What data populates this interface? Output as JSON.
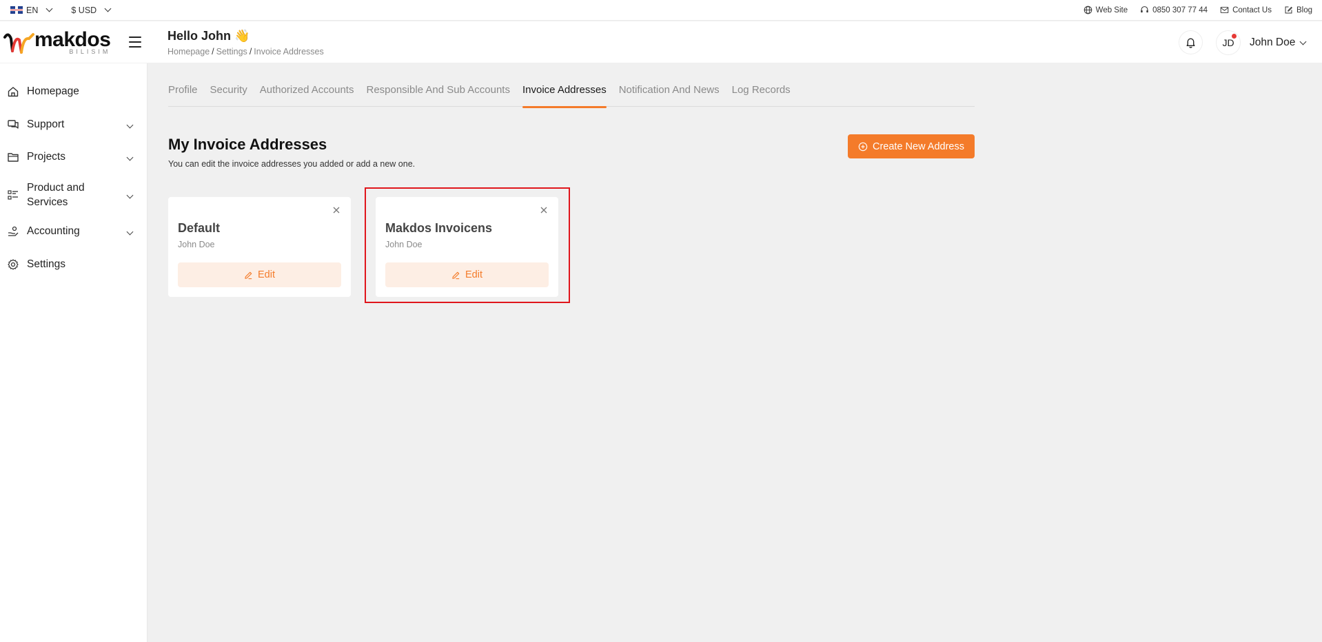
{
  "topbar": {
    "language": "EN",
    "currency": "$ USD",
    "links": [
      {
        "label": "Web Site",
        "icon": "globe-icon"
      },
      {
        "label": "0850 307 77 44",
        "icon": "headset-icon"
      },
      {
        "label": "Contact Us",
        "icon": "mail-icon"
      },
      {
        "label": "Blog",
        "icon": "edit-square-icon"
      }
    ]
  },
  "header": {
    "logo_word": "makdos",
    "logo_sub": "BILISIM",
    "greeting": "Hello John 👋",
    "breadcrumb": [
      "Homepage",
      "Settings",
      "Invoice Addresses"
    ],
    "avatar_initials": "JD",
    "user_name": "John Doe"
  },
  "sidebar": {
    "items": [
      {
        "label": "Homepage",
        "icon": "home-icon",
        "expandable": false
      },
      {
        "label": "Support",
        "icon": "chat-icon",
        "expandable": true
      },
      {
        "label": "Projects",
        "icon": "folder-icon",
        "expandable": true
      },
      {
        "label": "Product and Services",
        "icon": "list-icon",
        "expandable": true
      },
      {
        "label": "Accounting",
        "icon": "hand-coins-icon",
        "expandable": true
      },
      {
        "label": "Settings",
        "icon": "gear-icon",
        "expandable": false
      }
    ]
  },
  "tabs": [
    {
      "label": "Profile",
      "active": false
    },
    {
      "label": "Security",
      "active": false
    },
    {
      "label": "Authorized Accounts",
      "active": false
    },
    {
      "label": "Responsible And Sub Accounts",
      "active": false
    },
    {
      "label": "Invoice Addresses",
      "active": true
    },
    {
      "label": "Notification And News",
      "active": false
    },
    {
      "label": "Log Records",
      "active": false
    }
  ],
  "main": {
    "title": "My Invoice Addresses",
    "description": "You can edit the invoice addresses you added or add a new one.",
    "create_button": "Create New Address",
    "cards": [
      {
        "title": "Default",
        "subtitle": "John Doe",
        "edit_label": "Edit"
      },
      {
        "title": "Makdos Invoicens",
        "subtitle": "John Doe",
        "edit_label": "Edit"
      }
    ]
  },
  "colors": {
    "accent": "#f47b2a",
    "accent_light": "#fdeee4",
    "highlight_border": "#e0151b",
    "background": "#f0f0f0"
  }
}
